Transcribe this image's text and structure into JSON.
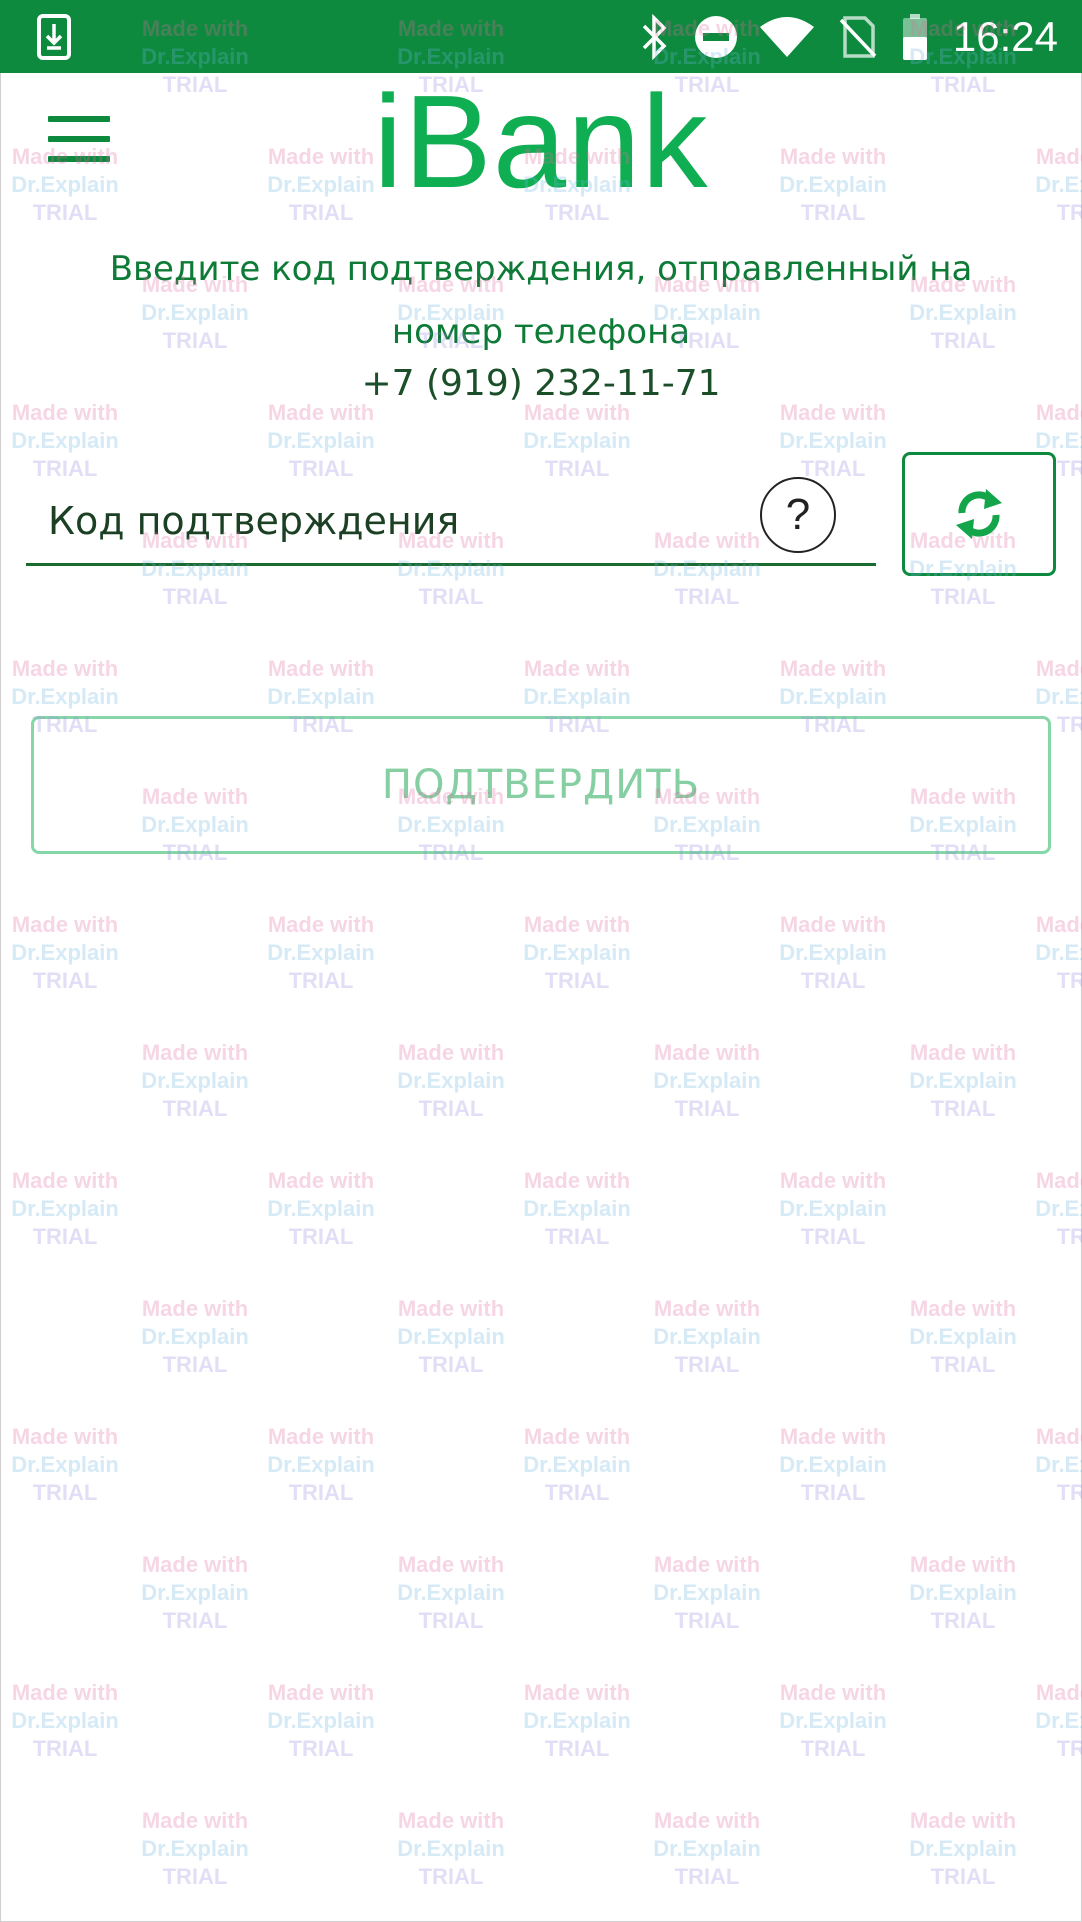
{
  "status_bar": {
    "time": "16:24",
    "icons": [
      "download-icon",
      "bluetooth-icon",
      "do-not-disturb-icon",
      "wifi-icon",
      "no-sim-icon",
      "battery-icon"
    ],
    "background_color": "#0d8a3e"
  },
  "header": {
    "logo_text": "iBank",
    "menu_icon": "hamburger-menu-icon"
  },
  "main": {
    "instruction_text": "Введите код подтверждения, отправленный на номер телефона",
    "phone_number": "+7 (919) 232-11-71",
    "code_input": {
      "value": "",
      "placeholder": "Код подтверждения"
    },
    "help_button_label": "?",
    "refresh_icon": "refresh-icon",
    "confirm_button_label": "ПОДТВЕРДИТЬ"
  },
  "watermark": {
    "line1": "Made with",
    "line2": "Dr.Explain",
    "line3": "TRIAL"
  },
  "colors": {
    "brand_green": "#0fae52",
    "dark_green": "#0d8a3e",
    "disabled_green": "#86cfa3"
  }
}
